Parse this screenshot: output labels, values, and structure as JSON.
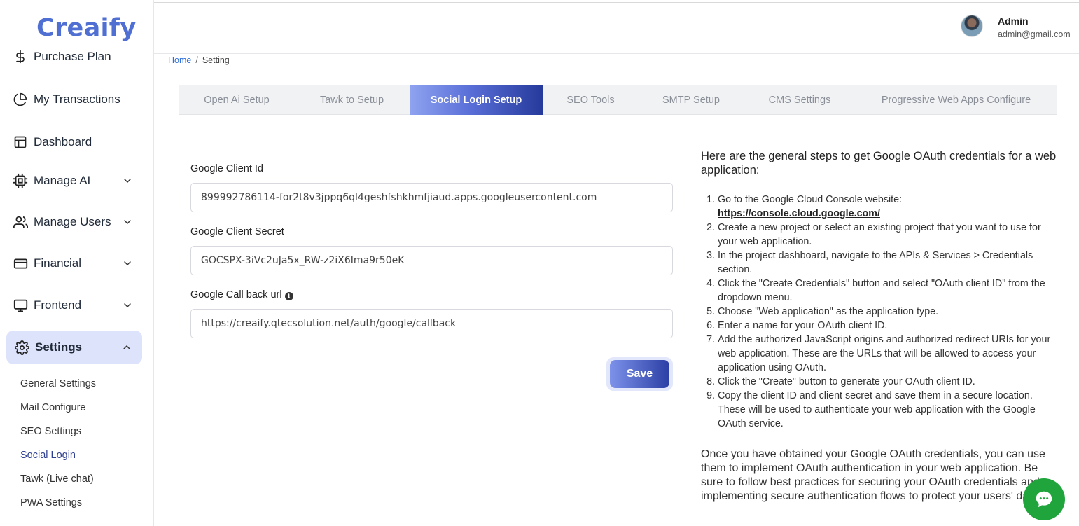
{
  "app": {
    "logo": "Creaify"
  },
  "sidebar": {
    "items": [
      {
        "label": "Purchase Plan",
        "icon": "dollar-icon"
      },
      {
        "label": "My Transactions",
        "icon": "pie-chart-icon"
      },
      {
        "label": "Dashboard",
        "icon": "layout-icon"
      },
      {
        "label": "Manage AI",
        "icon": "cpu-icon"
      },
      {
        "label": "Manage Users",
        "icon": "users-icon"
      },
      {
        "label": "Financial",
        "icon": "credit-card-icon"
      },
      {
        "label": "Frontend",
        "icon": "monitor-icon"
      },
      {
        "label": "Settings",
        "icon": "gear-icon"
      }
    ],
    "settings_sub": [
      "General Settings",
      "Mail Configure",
      "SEO Settings",
      "Social Login",
      "Tawk (Live chat)",
      "PWA Settings"
    ]
  },
  "header": {
    "admin_name": "Admin",
    "admin_email": "admin@gmail.com"
  },
  "breadcrumb": {
    "home": "Home",
    "separator": "/",
    "current": "Setting"
  },
  "tabs": [
    "Open Ai Setup",
    "Tawk to Setup",
    "Social Login Setup",
    "SEO Tools",
    "SMTP Setup",
    "CMS Settings",
    "Progressive Web Apps Configure"
  ],
  "form": {
    "client_id_label": "Google Client Id",
    "client_id_value": "899992786114-for2t8v3jppq6ql4geshfshkhmfjiaud.apps.googleusercontent.com",
    "client_secret_label": "Google Client Secret",
    "client_secret_value": "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",
    "callback_label": "Google Call back url",
    "callback_value": "https://creaify.qtecsolution.net/auth/google/callback",
    "save_label": "Save"
  },
  "help": {
    "heading": "Here are the general steps to get Google OAuth credentials for a web application:",
    "step1_text": "Go to the Google Cloud Console website: ",
    "step1_link": "https://console.cloud.google.com/",
    "steps": [
      "Create a new project or select an existing project that you want to use for your web application.",
      "In the project dashboard, navigate to the APIs & Services > Credentials section.",
      "Click the \"Create Credentials\" button and select \"OAuth client ID\" from the dropdown menu.",
      "Choose \"Web application\" as the application type.",
      "Enter a name for your OAuth client ID.",
      "Add the authorized JavaScript origins and authorized redirect URIs for your web application. These are the URLs that will be allowed to access your application using OAuth.",
      "Click the \"Create\" button to generate your OAuth client ID.",
      "Copy the client ID and client secret and save them in a secure location. These will be used to authenticate your web application with the Google OAuth service."
    ],
    "outro": "Once you have obtained your Google OAuth credentials, you can use them to implement OAuth authentication in your web application. Be sure to follow best practices for securing your OAuth credentials and implementing secure authentication flows to protect your users' data."
  },
  "colors": {
    "accent": "#4f6fd3",
    "active_bg": "#dde3fb",
    "chat": "#1fa53c"
  }
}
